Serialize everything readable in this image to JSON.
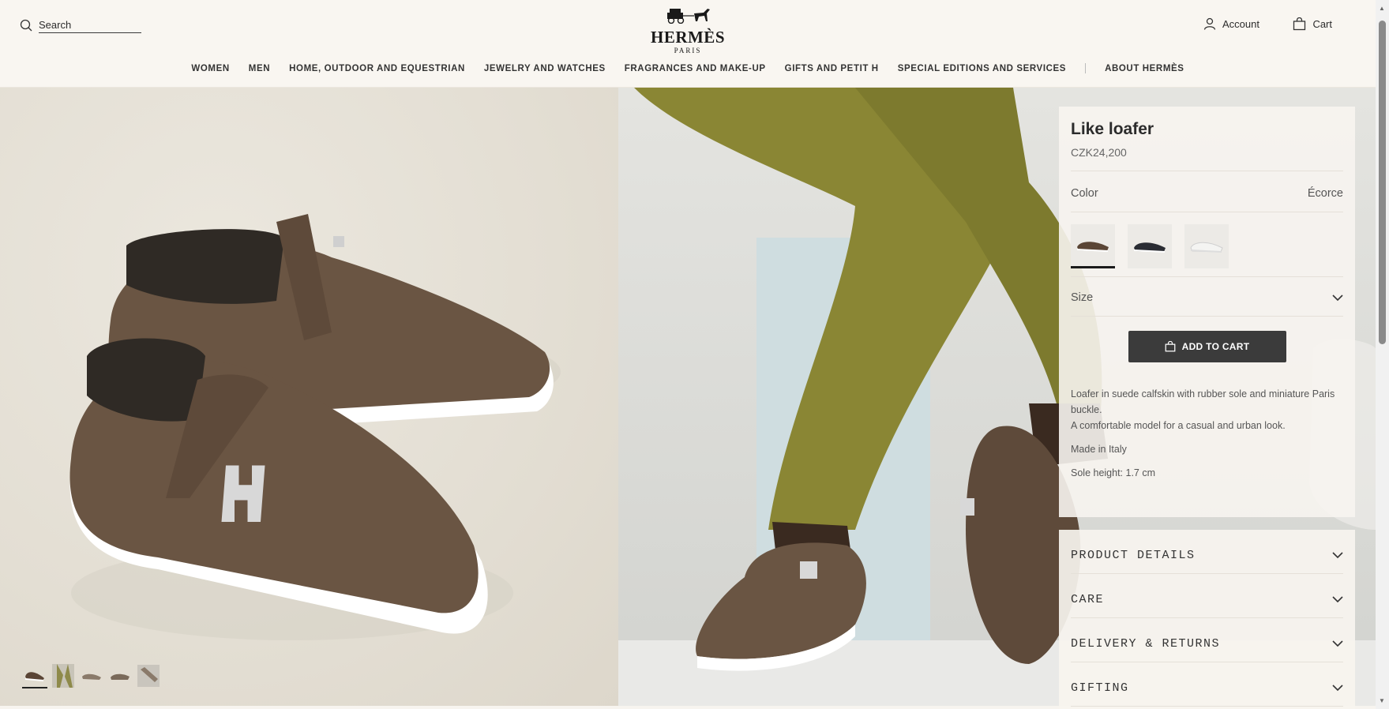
{
  "header": {
    "search_placeholder": "Search",
    "logo_text": "HERMÈS",
    "logo_sub": "PARIS",
    "account_label": "Account",
    "cart_label": "Cart"
  },
  "nav": {
    "items": [
      "WOMEN",
      "MEN",
      "HOME, OUTDOOR AND EQUESTRIAN",
      "JEWELRY AND WATCHES",
      "FRAGRANCES AND MAKE-UP",
      "GIFTS AND PETIT H",
      "SPECIAL EDITIONS AND SERVICES"
    ],
    "about": "ABOUT HERMÈS"
  },
  "gallery": {
    "thumbnail_count": 5,
    "active_thumbnail": 1
  },
  "product": {
    "title": "Like loafer",
    "price": "CZK24,200",
    "color_label": "Color",
    "color_value": "Écorce",
    "swatches": [
      "brown",
      "black",
      "white"
    ],
    "size_label": "Size",
    "add_to_cart": "ADD TO CART",
    "description_1": "Loafer in suede calfskin with rubber sole and miniature Paris buckle.",
    "description_2": "A comfortable model for a casual and urban look.",
    "made_in": "Made in Italy",
    "sole_height": "Sole height: 1.7 cm"
  },
  "accordion": [
    "PRODUCT DETAILS",
    "CARE",
    "DELIVERY & RETURNS",
    "GIFTING"
  ],
  "colors": {
    "button_bg": "#3b3b3b",
    "page_bg": "#f7f4ef",
    "suede_brown": "#6a5543"
  }
}
